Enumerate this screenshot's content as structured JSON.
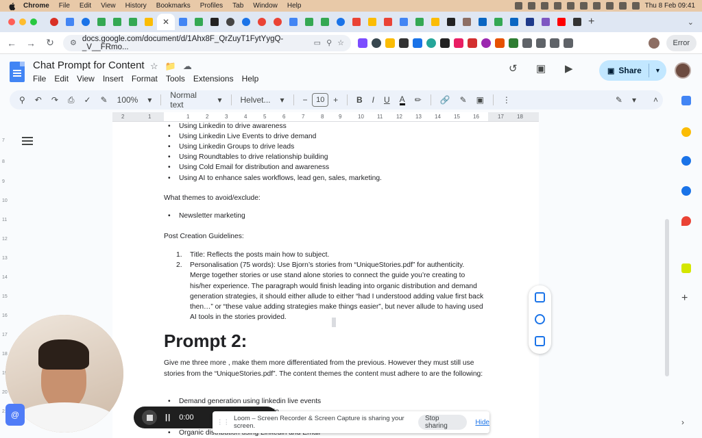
{
  "menubar": {
    "app": "Chrome",
    "items": [
      "File",
      "Edit",
      "View",
      "History",
      "Bookmarks",
      "Profiles",
      "Tab",
      "Window",
      "Help"
    ],
    "datetime": "Thu 8 Feb  09:41"
  },
  "browser": {
    "url": "docs.google.com/document/d/1Ahx8F_QrZuyT1FytYygQ-_V__FRmo...",
    "error_label": "Error",
    "active_tab_glyph": "✕"
  },
  "doc": {
    "title": "Chat Prompt for Content",
    "menu": [
      "File",
      "Edit",
      "View",
      "Insert",
      "Format",
      "Tools",
      "Extensions",
      "Help"
    ],
    "share_label": "Share"
  },
  "toolbar": {
    "zoom": "100%",
    "style": "Normal text",
    "font": "Helvet...",
    "font_size": "10",
    "bold": "B",
    "italic": "I",
    "underline": "U",
    "textcolor": "A"
  },
  "ruler": {
    "labels": [
      "2",
      "1",
      "1",
      "2",
      "3",
      "4",
      "5",
      "6",
      "7",
      "8",
      "9",
      "10",
      "11",
      "12",
      "13",
      "14",
      "15",
      "16",
      "17",
      "18"
    ]
  },
  "left_ruler": [
    "7",
    "8",
    "9",
    "10",
    "11",
    "12",
    "13",
    "14",
    "15",
    "16",
    "17",
    "18",
    "19",
    "20",
    "21"
  ],
  "content": {
    "bullets_top": [
      "Using Linkedin to drive awareness",
      "Using Linkedin Live Events to drive demand",
      "Using Linkedin Groups to drive leads",
      "Using Roundtables to drive relationship building",
      "Using Cold Email for distribution and awareness",
      "Using AI to enhance sales workflows, lead gen, sales, marketing."
    ],
    "avoid_heading": "What themes to avoid/exclude:",
    "avoid_bullets": [
      "Newsletter marketing"
    ],
    "guidelines_heading": "Post Creation Guidelines:",
    "guidelines": [
      {
        "num": "1.",
        "text": "Title: Reflects the posts main how to subject."
      },
      {
        "num": "2.",
        "text": "Personalisation (75 words): Use Bjorn’s stories from “UniqueStories.pdf” for authenticity. Merge together stories or use stand alone stories to connect the guide you’re creating to his/her experience. The paragraph would finish leading into organic distribution and demand generation strategies, it should either allude to either “had I understood adding value first back then…” or “these value adding strategies make things easier”, but never allude to having used AI tools in the stories provided."
      }
    ],
    "prompt2_heading": "Prompt 2:",
    "prompt2_text": "Give me three more , make them more differentiated from the previous. However they must still use stories from the “UniqueStories.pdf”. The content themes the content must adhere to are the following:",
    "bullets_bottom": [
      "Demand generation using linkedin live events",
      "Thought leadership via LinkedIn",
      "Organic distribution using Linkedin and Email"
    ]
  },
  "recorder": {
    "timer": "0:00",
    "share_message": "Loom – Screen Recorder & Screen Capture is sharing your screen.",
    "stop_label": "Stop sharing",
    "hide_label": "Hide"
  }
}
